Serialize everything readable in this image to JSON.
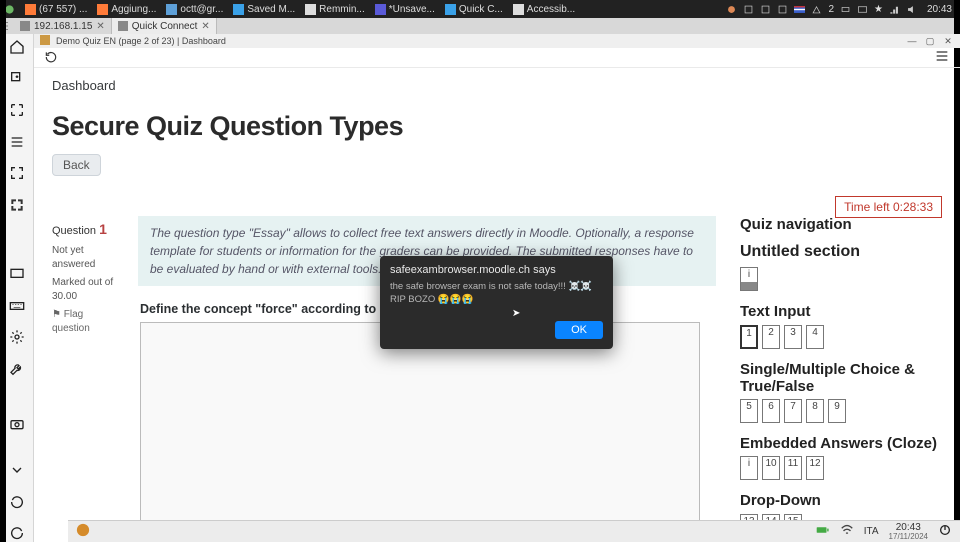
{
  "sysbar": {
    "tasks": [
      {
        "label": "(67 557) ...",
        "color": "#ff7b39"
      },
      {
        "label": "Aggiung...",
        "color": "#ff7b39"
      },
      {
        "label": "octt@gr...",
        "color": "#5ea0d8"
      },
      {
        "label": "Saved M...",
        "color": "#3aa1e8"
      },
      {
        "label": "Remmin...",
        "color": "#dddddd"
      },
      {
        "label": "*Unsave...",
        "color": "#5a5ad8"
      },
      {
        "label": "Quick C...",
        "color": "#3aa1e8"
      },
      {
        "label": "Accessib...",
        "color": "#dddddd"
      }
    ],
    "clock": "20:43"
  },
  "tabstrip": {
    "tabs": [
      {
        "label": "192.168.1.15"
      },
      {
        "label": "Quick Connect",
        "active": true
      }
    ]
  },
  "wtitle": "Demo Quiz EN (page 2 of 23) | Dashboard",
  "crumb": "Dashboard",
  "heading": "Secure Quiz Question Types",
  "back_label": "Back",
  "timer": "Time left 0:28:33",
  "qinfo": {
    "question_label": "Question",
    "number": "1",
    "state": "Not yet answered",
    "marks": "Marked out of 30.00",
    "flag": "Flag question"
  },
  "qbody": {
    "intro": "The question type \"Essay\" allows to collect free text answers directly in Moodle. Optionally, a response template for students or information for the graders can be provided. The submitted responses have to be evaluated by hand or with external tools.",
    "task": "Define the concept \"force\" according to Newton in three"
  },
  "alert": {
    "title": "safeexambrowser.moodle.ch says",
    "message": "the safe browser exam is not safe today!!! ☠️☠️ RIP BOZO 😭😭😭",
    "ok": "OK"
  },
  "nav": {
    "title": "Quiz navigation",
    "sections": [
      {
        "title": "Untitled section",
        "cells": [
          {
            "label": "i",
            "filled": true,
            "current": false
          }
        ],
        "h": "h5"
      },
      {
        "title": "Text Input",
        "cells": [
          {
            "label": "1",
            "current": true
          },
          {
            "label": "2"
          },
          {
            "label": "3"
          },
          {
            "label": "4"
          }
        ],
        "h": "h6"
      },
      {
        "title": "Single/Multiple Choice & True/False",
        "cells": [
          {
            "label": "5"
          },
          {
            "label": "6"
          },
          {
            "label": "7"
          },
          {
            "label": "8"
          },
          {
            "label": "9"
          }
        ],
        "h": "h6"
      },
      {
        "title": "Embedded Answers (Cloze)",
        "cells": [
          {
            "label": "i"
          },
          {
            "label": "10"
          },
          {
            "label": "11"
          },
          {
            "label": "12"
          }
        ],
        "h": "h6"
      },
      {
        "title": "Drop-Down",
        "cells": [
          {
            "label": "13"
          },
          {
            "label": "14"
          },
          {
            "label": "15"
          }
        ],
        "h": "h6"
      }
    ]
  },
  "status": {
    "lang": "ITA",
    "clock": "20:43",
    "date": "17/11/2024"
  }
}
